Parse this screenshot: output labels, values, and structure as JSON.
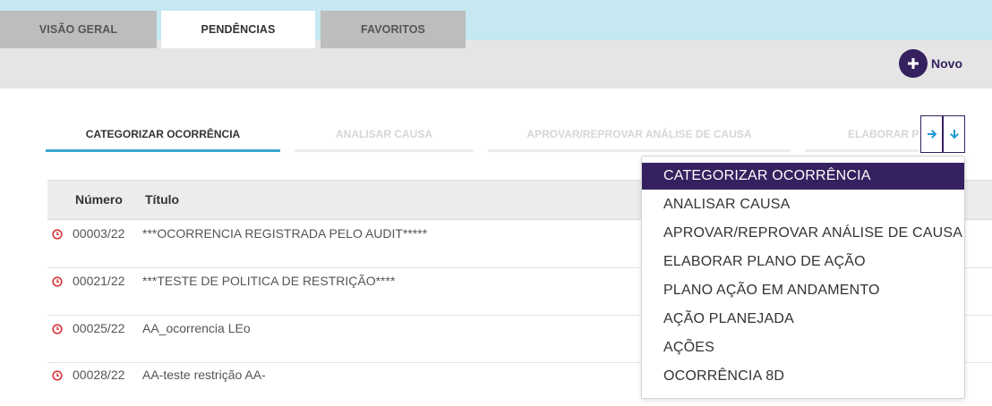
{
  "topbar": {
    "home_icon": "home-icon"
  },
  "main_tabs": [
    {
      "label": "VISÃO GERAL",
      "active": false
    },
    {
      "label": "PENDÊNCIAS",
      "active": true
    },
    {
      "label": "FAVORITOS",
      "active": false
    }
  ],
  "novo_button": {
    "icon": "plus-icon",
    "label": "Novo"
  },
  "step_tabs": [
    {
      "label": "CATEGORIZAR OCORRÊNCIA",
      "active": true
    },
    {
      "label": "ANALISAR CAUSA",
      "active": false
    },
    {
      "label": "APROVAR/REPROVAR ANÁLISE DE CAUSA",
      "active": false
    },
    {
      "label": "ELABORAR PLANO DE AÇÃO",
      "active": false
    }
  ],
  "step_nav": {
    "next_icon": "arrow-right-icon",
    "dropdown_icon": "arrow-down-icon"
  },
  "table": {
    "columns": [
      "Número",
      "Título"
    ],
    "rows": [
      {
        "status_icon": "clock-icon",
        "numero": "00003/22",
        "titulo": "***OCORRENCIA REGISTRADA PELO AUDIT*****"
      },
      {
        "status_icon": "clock-icon",
        "numero": "00021/22",
        "titulo": "***TESTE DE POLITICA DE RESTRIÇÃO****"
      },
      {
        "status_icon": "clock-icon",
        "numero": "00025/22",
        "titulo": "AA_ocorrencia LEo"
      },
      {
        "status_icon": "clock-icon",
        "numero": "00028/22",
        "titulo": "AA-teste restrição AA-"
      }
    ]
  },
  "step_dropdown": {
    "selected": "CATEGORIZAR OCORRÊNCIA",
    "items": [
      "CATEGORIZAR OCORRÊNCIA",
      "ANALISAR CAUSA",
      "APROVAR/REPROVAR ANÁLISE DE CAUSA",
      "ELABORAR PLANO DE AÇÃO",
      "PLANO AÇÃO EM ANDAMENTO",
      "AÇÃO PLANEJADA",
      "AÇÕES",
      "OCORRÊNCIA 8D"
    ]
  },
  "colors": {
    "topbar": "#c5e8f2",
    "brand_purple": "#35215f",
    "accent_blue": "#3aa6cf",
    "status_red": "#d9343a"
  }
}
